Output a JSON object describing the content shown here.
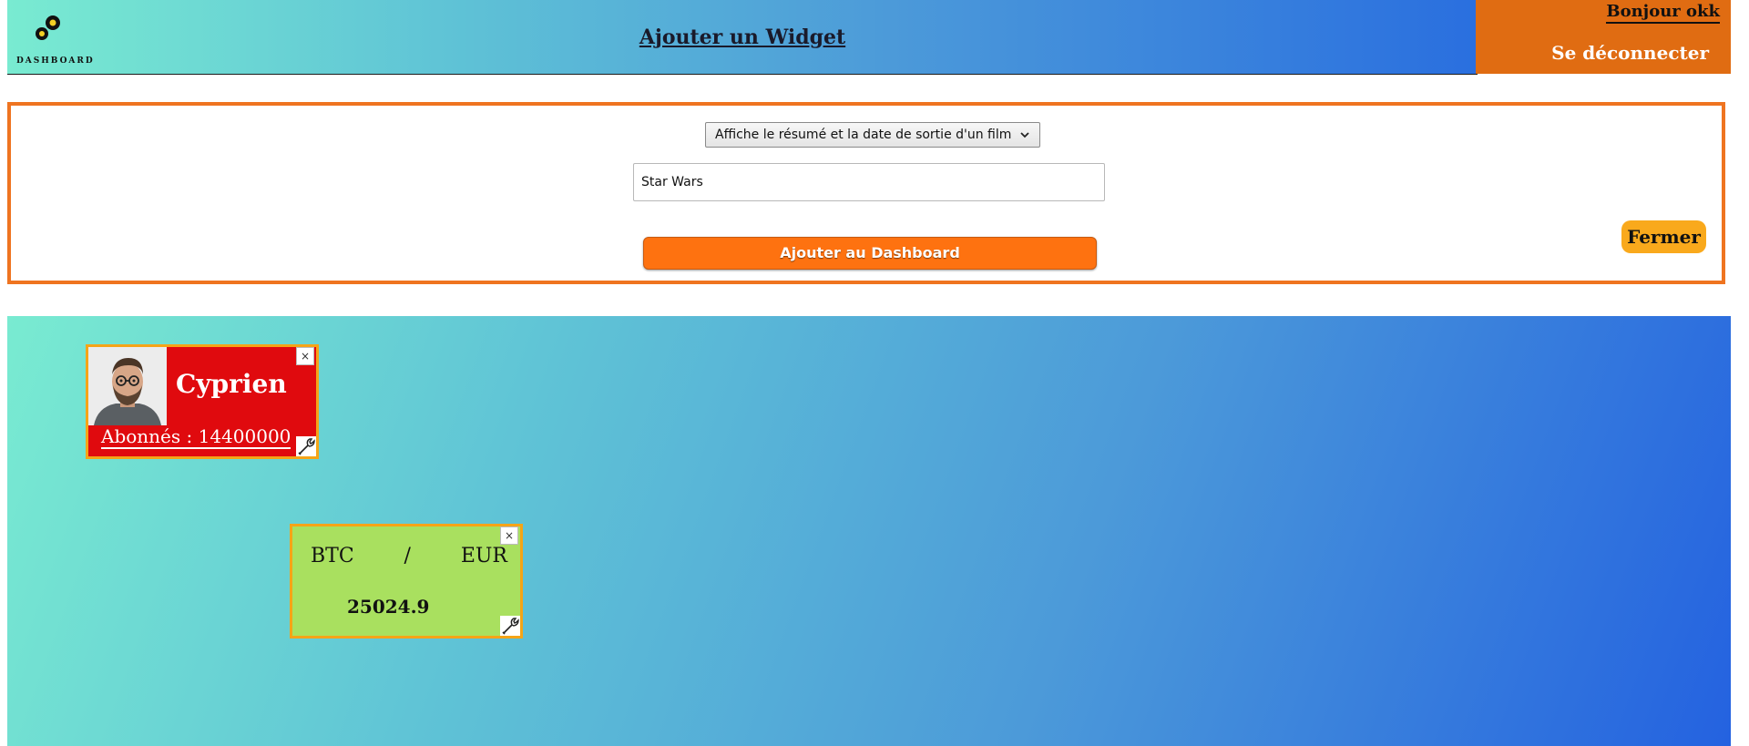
{
  "header": {
    "logo_text": "DASHBOARD",
    "title": "Ajouter un Widget",
    "greeting": "Bonjour okk",
    "logout_label": "Se déconnecter"
  },
  "add_panel": {
    "service_select": "Affiche le résumé et la date de sortie d'un film",
    "input_value": "Star Wars",
    "add_button_label": "Ajouter au Dashboard",
    "close_button_label": "Fermer"
  },
  "widgets": {
    "youtube": {
      "channel_name": "Cyprien",
      "subscribers_text": "Abonnés : 14400000",
      "close_glyph": "×"
    },
    "crypto": {
      "base": "BTC",
      "separator": "/",
      "quote": "EUR",
      "rate": "25024.9",
      "close_glyph": "×"
    }
  },
  "colors": {
    "header_accent": "#e06c12",
    "panel_border": "#ef7420",
    "add_button": "#fe7210",
    "close_button": "#f9a91c",
    "youtube_widget": "#e00a0e",
    "crypto_widget": "#a9e05f"
  }
}
